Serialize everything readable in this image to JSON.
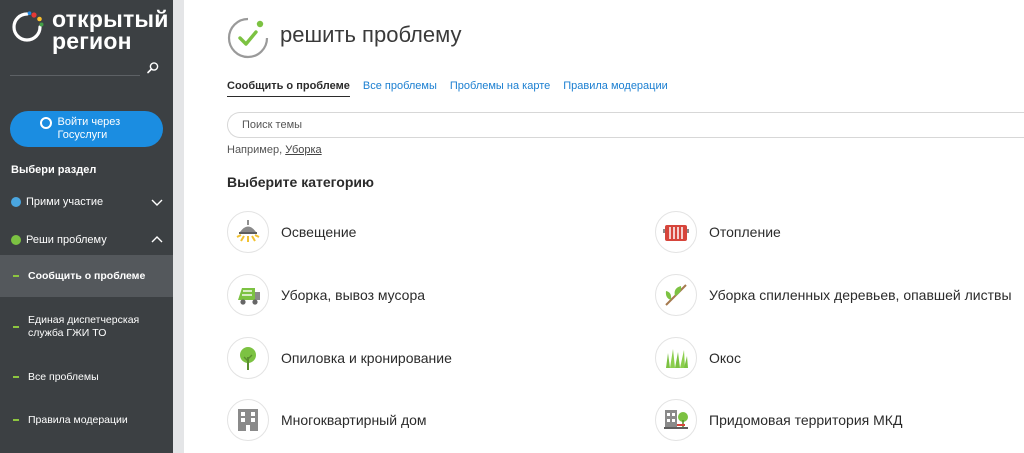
{
  "brand": {
    "line1": "открытый",
    "line2": "регион",
    "dot_colors": [
      "#e53935",
      "#fbc02d",
      "#43a047",
      "#1e88e5"
    ]
  },
  "sidebar": {
    "gosuslugi_label": "Войти через Госуслуги",
    "section_title": "Выбери раздел",
    "nav": [
      {
        "label": "Прими участие",
        "dot_color": "#4aa6e0",
        "expanded": false
      },
      {
        "label": "Реши проблему",
        "dot_color": "#7cc242",
        "expanded": true
      }
    ],
    "sub_items": [
      {
        "label": "Сообщить о проблеме",
        "active": true
      },
      {
        "label": "Единая диспетчерская служба ГЖИ ТО",
        "active": false
      },
      {
        "label": "Все проблемы",
        "active": false
      },
      {
        "label": "Правила модерации",
        "active": false
      }
    ]
  },
  "header": {
    "title": "решить проблему"
  },
  "tabs": [
    {
      "label": "Сообщить о проблеме",
      "active": true
    },
    {
      "label": "Все проблемы",
      "active": false
    },
    {
      "label": "Проблемы на карте",
      "active": false
    },
    {
      "label": "Правила модерации",
      "active": false
    }
  ],
  "search": {
    "placeholder": "Поиск темы",
    "value": ""
  },
  "example": {
    "prefix": "Например,",
    "link": "Уборка"
  },
  "categories_title": "Выберите категорию",
  "categories": [
    {
      "label": "Освещение",
      "icon": "lamp-icon"
    },
    {
      "label": "Отопление",
      "icon": "radiator-icon"
    },
    {
      "label": "Уборка, вывоз мусора",
      "icon": "garbage-truck-icon"
    },
    {
      "label": "Уборка спиленных деревьев, опавшей листвы",
      "icon": "branch-icon"
    },
    {
      "label": "Опиловка и кронирование",
      "icon": "tree-icon"
    },
    {
      "label": "Окос",
      "icon": "grass-icon"
    },
    {
      "label": "Многоквартирный дом",
      "icon": "apartment-building-icon"
    },
    {
      "label": "Придомовая территория МКД",
      "icon": "courtyard-icon"
    }
  ]
}
